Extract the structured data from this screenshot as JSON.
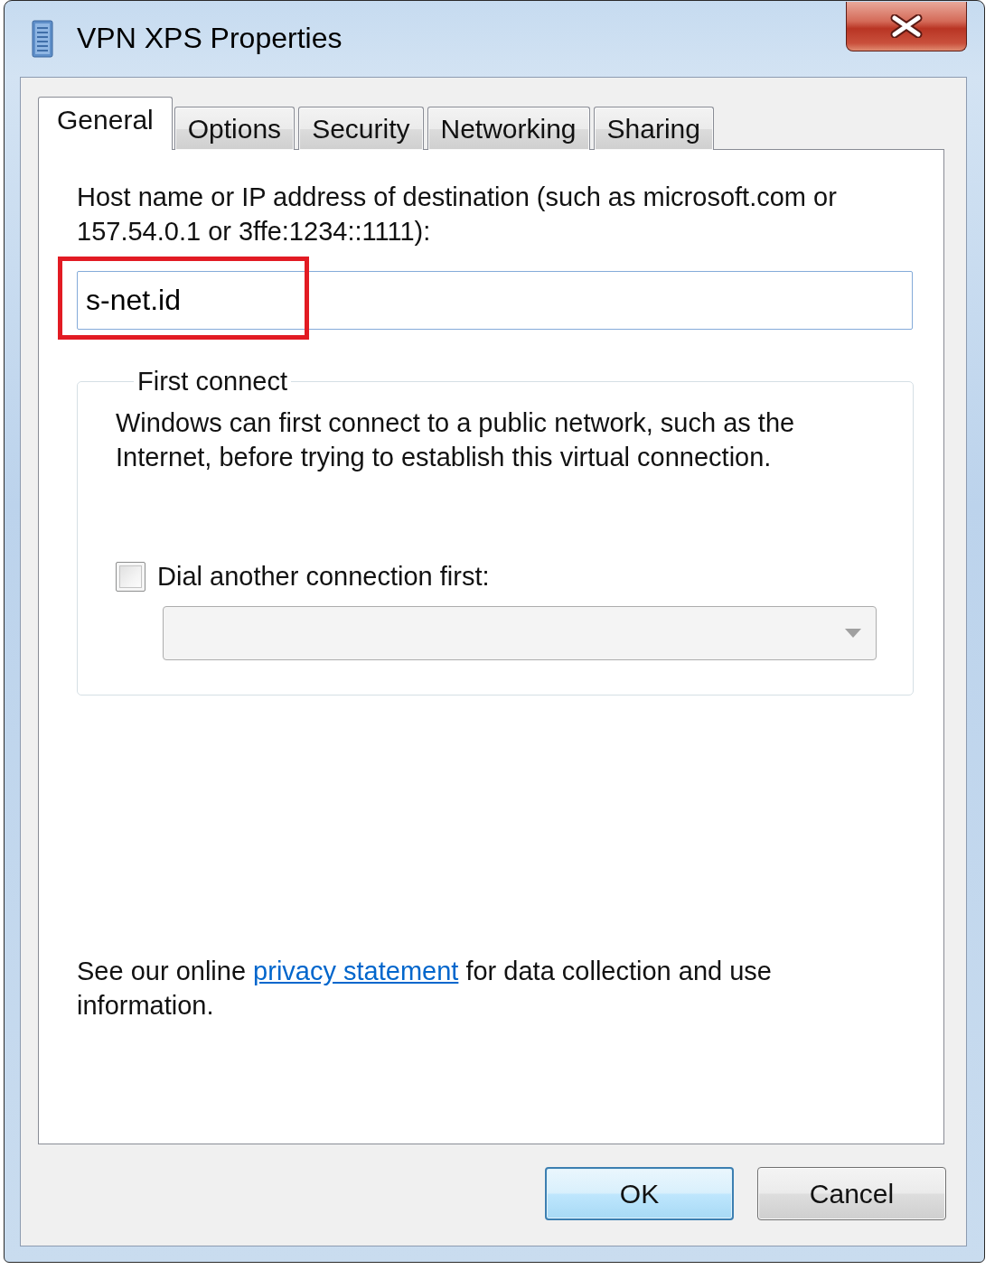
{
  "window": {
    "title": "VPN XPS Properties"
  },
  "tabs": [
    {
      "label": "General",
      "selected": true
    },
    {
      "label": "Options",
      "selected": false
    },
    {
      "label": "Security",
      "selected": false
    },
    {
      "label": "Networking",
      "selected": false
    },
    {
      "label": "Sharing",
      "selected": false
    }
  ],
  "host": {
    "label": "Host name or IP address of destination (such as microsoft.com or 157.54.0.1 or 3ffe:1234::1111):",
    "value": "s-net.id",
    "highlighted": true
  },
  "first_connect": {
    "legend": "First connect",
    "description": "Windows can first connect to a public network, such as the Internet, before trying to establish this virtual connection.",
    "dial_checkbox": {
      "label": "Dial another connection first:",
      "checked": false
    },
    "connection_dropdown": {
      "disabled": true
    }
  },
  "privacy_note": {
    "before": "See our online",
    "link": "privacy statement",
    "after": "for data collection and use information."
  },
  "buttons": [
    {
      "label": "OK",
      "default": true
    },
    {
      "label": "Cancel",
      "default": false
    }
  ]
}
